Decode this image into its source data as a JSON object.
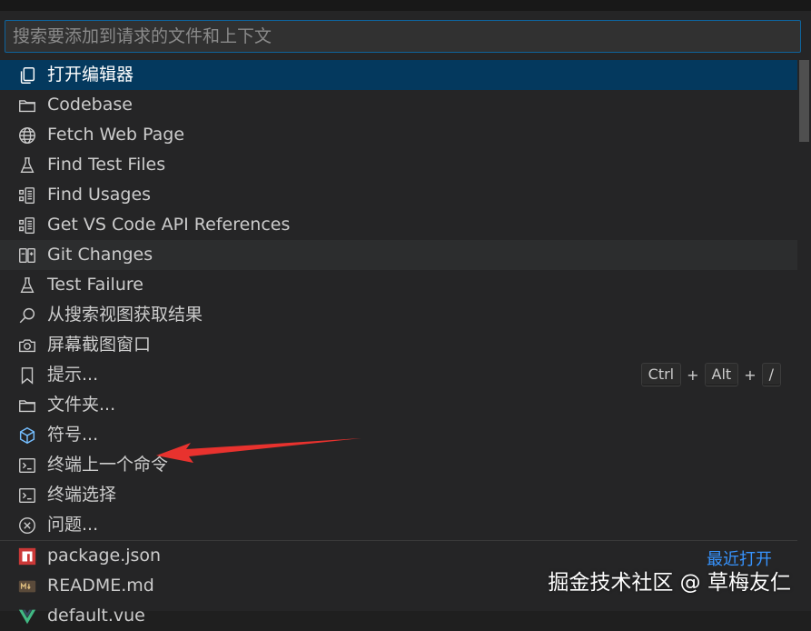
{
  "search": {
    "placeholder": "搜索要添加到请求的文件和上下文"
  },
  "items": [
    {
      "label": "打开编辑器",
      "icon": "copy-files-icon"
    },
    {
      "label": "Codebase",
      "icon": "folder-icon"
    },
    {
      "label": "Fetch Web Page",
      "icon": "globe-icon"
    },
    {
      "label": "Find Test Files",
      "icon": "beaker-icon"
    },
    {
      "label": "Find Usages",
      "icon": "references-icon"
    },
    {
      "label": "Get VS Code API References",
      "icon": "references-icon"
    },
    {
      "label": "Git Changes",
      "icon": "diff-icon"
    },
    {
      "label": "Test Failure",
      "icon": "beaker-icon"
    },
    {
      "label": "从搜索视图获取结果",
      "icon": "search-icon"
    },
    {
      "label": "屏幕截图窗口",
      "icon": "camera-icon"
    },
    {
      "label": "提示...",
      "icon": "bookmark-icon"
    },
    {
      "label": "文件夹...",
      "icon": "folder-icon"
    },
    {
      "label": "符号...",
      "icon": "symbol-icon"
    },
    {
      "label": "终端上一个命令",
      "icon": "terminal-icon"
    },
    {
      "label": "终端选择",
      "icon": "terminal-icon"
    },
    {
      "label": "问题...",
      "icon": "error-circle-icon"
    }
  ],
  "shortcut": {
    "keys": [
      "Ctrl",
      "Alt",
      "/"
    ],
    "plus": "+"
  },
  "recent": {
    "label": "最近打开",
    "files": [
      {
        "label": "package.json",
        "icon": "npm-icon"
      },
      {
        "label": "README.md",
        "icon": "markdown-icon"
      },
      {
        "label": "default.vue",
        "icon": "vue-icon"
      }
    ]
  },
  "watermark": "掘金技术社区 @ 草梅友仁",
  "colors": {
    "selected_bg": "#04395e",
    "accent_blue": "#3794ff",
    "arrow_red": "#e8322e"
  }
}
